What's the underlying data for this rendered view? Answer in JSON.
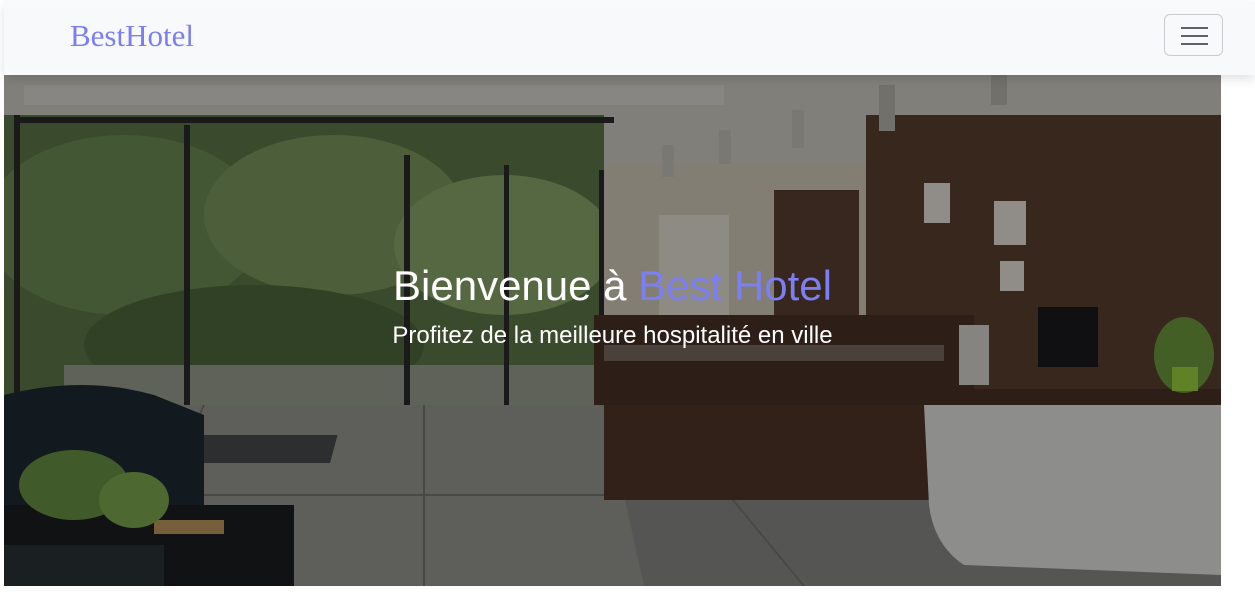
{
  "navbar": {
    "brand": "BestHotel",
    "toggler_icon": "hamburger-menu-icon"
  },
  "hero": {
    "title_prefix": "Bienvenue à ",
    "title_highlight": "Best Hotel",
    "subtitle": "Profitez de la meilleure hospitalité en ville",
    "image": "hotel-lobby-reception-photo"
  },
  "colors": {
    "accent": "#7b7ff0",
    "navbar_bg": "#f8f9fa"
  }
}
